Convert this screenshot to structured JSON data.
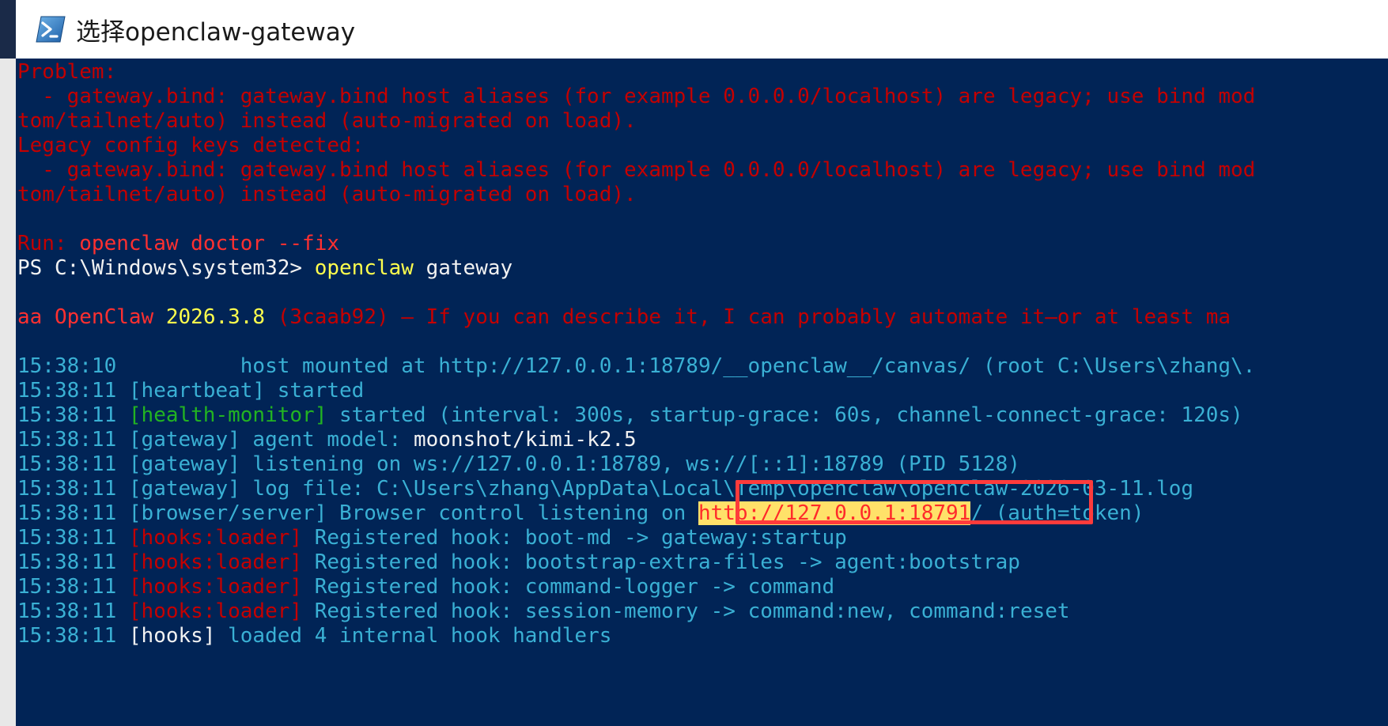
{
  "window": {
    "title": "选择openclaw-gateway",
    "icon": "powershell-icon"
  },
  "colors": {
    "console_bg": "#012456",
    "error_red": "#c40000",
    "command_yellow": "#ffff4d",
    "highlight_box": "#ff3b3b",
    "selection_bg": "#ffe169"
  },
  "console": {
    "lines": {
      "l1": "Problem:",
      "l2": "  - gateway.bind: gateway.bind host aliases (for example 0.0.0.0/localhost) are legacy; use bind mod",
      "l3": "tom/tailnet/auto) instead (auto-migrated on load).",
      "l4": "Legacy config keys detected:",
      "l5": "  - gateway.bind: gateway.bind host aliases (for example 0.0.0.0/localhost) are legacy; use bind mod",
      "l6": "tom/tailnet/auto) instead (auto-migrated on load).",
      "run_label": "Run: ",
      "run_cmd": "openclaw doctor --fix",
      "prompt": "PS C:\\Windows\\system32> ",
      "prompt_cmd": "openclaw",
      "prompt_arg": " gateway",
      "banner_prefix": "aa ",
      "banner_name": "OpenClaw ",
      "banner_version": "2026.3.8",
      "banner_rest": " (3caab92) — If you can describe it, I can probably automate it—or at least ma",
      "t1_time": "15:38:10",
      "t1_text": "          host mounted at http://127.0.0.1:18789/__openclaw__/canvas/ (root C:\\Users\\zhang\\.",
      "t2_time": "15:38:11",
      "t2_tag": " [heartbeat]",
      "t2_text": " started",
      "t3_time": "15:38:11",
      "t3_tag": " [health-monitor]",
      "t3_text": " started (interval: 300s, startup-grace: 60s, channel-connect-grace: 120s)",
      "t4_time": "15:38:11",
      "t4_tag": " [gateway]",
      "t4_text": " agent model: ",
      "t4_model": "moonshot/kimi-k2.5",
      "t5_time": "15:38:11",
      "t5_tag": " [gateway]",
      "t5_text": " listening on ws://127.0.0.1:18789, ws://[::1]:18789 (PID 5128)",
      "t6_time": "15:38:11",
      "t6_tag": " [gateway]",
      "t6_text": " log file: C:\\Users\\zhang\\AppData\\Local\\Temp\\openclaw\\openclaw-2026-03-11.log",
      "t7_time": "15:38:11",
      "t7_tag": " [browser/server]",
      "t7_text": " Browser control listening on ",
      "t7_url": "http://127.0.0.1:18791",
      "t7_after": "/ (auth=token)",
      "t8_time": "15:38:11",
      "t8_tag": " [hooks:loader]",
      "t8_text": " Registered hook: boot-md -> gateway:startup",
      "t9_time": "15:38:11",
      "t9_tag": " [hooks:loader]",
      "t9_text": " Registered hook: bootstrap-extra-files -> agent:bootstrap",
      "t10_time": "15:38:11",
      "t10_tag": " [hooks:loader]",
      "t10_text": " Registered hook: command-logger -> command",
      "t11_time": "15:38:11",
      "t11_tag": " [hooks:loader]",
      "t11_text": " Registered hook: session-memory -> command:new, command:reset",
      "t12_time": "15:38:11",
      "t12_tag": " [hooks]",
      "t12_text": " loaded 4 internal hook handlers"
    }
  }
}
